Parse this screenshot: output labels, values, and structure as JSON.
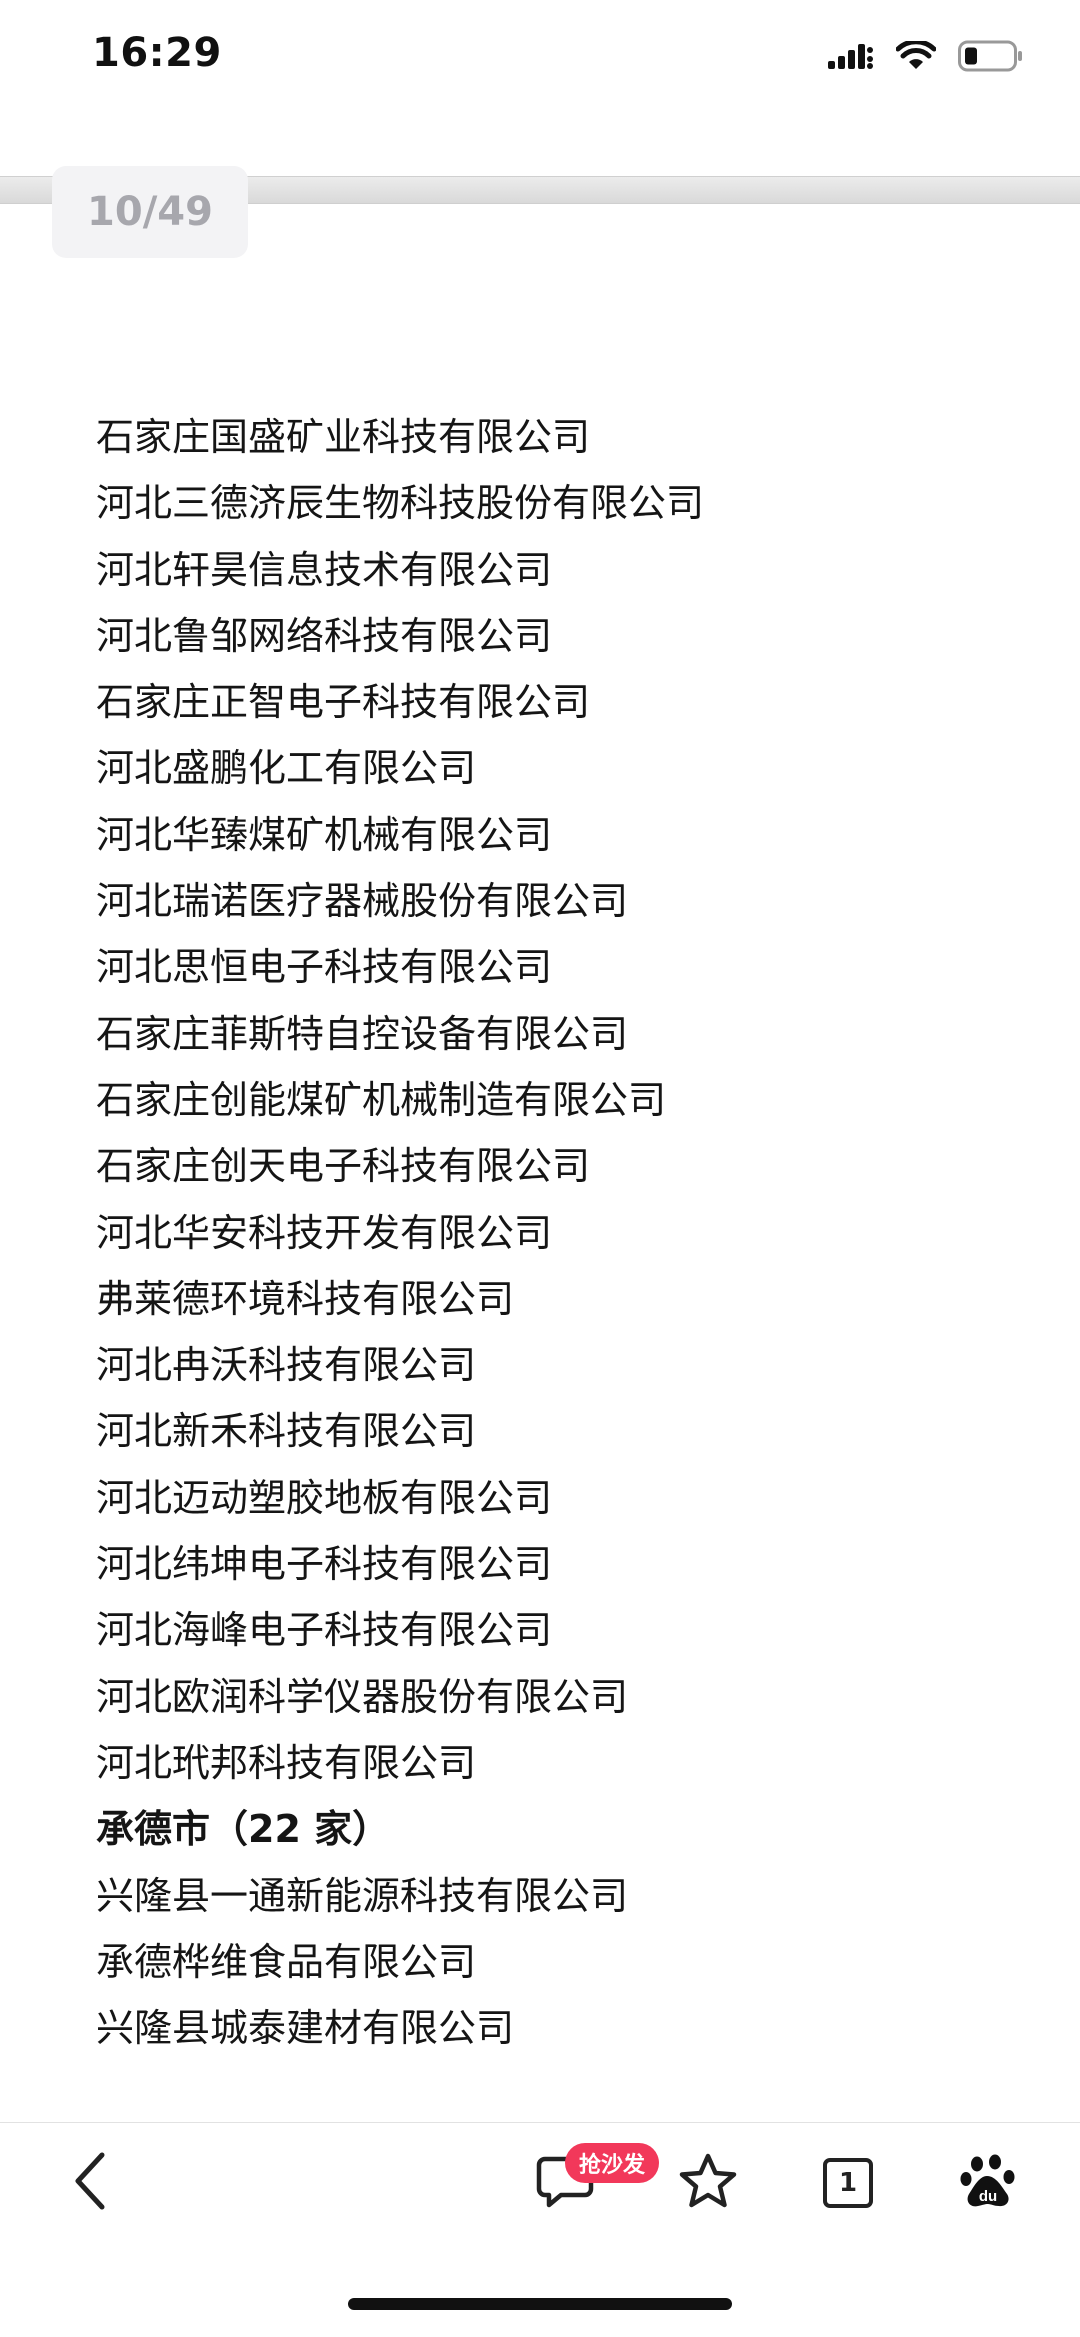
{
  "status_bar": {
    "time": "16:29"
  },
  "page_indicator": "10/49",
  "companies": [
    "石家庄国盛矿业科技有限公司",
    "河北三德济辰生物科技股份有限公司",
    "河北轩昊信息技术有限公司",
    "河北鲁邹网络科技有限公司",
    "石家庄正智电子科技有限公司",
    "河北盛鹏化工有限公司",
    "河北华臻煤矿机械有限公司",
    "河北瑞诺医疗器械股份有限公司",
    "河北思恒电子科技有限公司",
    "石家庄菲斯特自控设备有限公司",
    "石家庄创能煤矿机械制造有限公司",
    "石家庄创天电子科技有限公司",
    "河北华安科技开发有限公司",
    "弗莱德环境科技有限公司",
    "河北冉沃科技有限公司",
    "河北新禾科技有限公司",
    "河北迈动塑胶地板有限公司",
    "河北纬坤电子科技有限公司",
    "河北海峰电子科技有限公司",
    "河北欧润科学仪器股份有限公司",
    "河北玳邦科技有限公司"
  ],
  "section_heading": "承德市（22 家）",
  "chengde_companies": [
    "兴隆县一通新能源科技有限公司",
    "承德桦维食品有限公司",
    "兴隆县城泰建材有限公司"
  ],
  "toolbar": {
    "comment_badge": "抢沙发",
    "tab_count": "1"
  },
  "colors": {
    "badge_bg": "#f2385a",
    "page_badge_text": "#a7a7ad"
  }
}
